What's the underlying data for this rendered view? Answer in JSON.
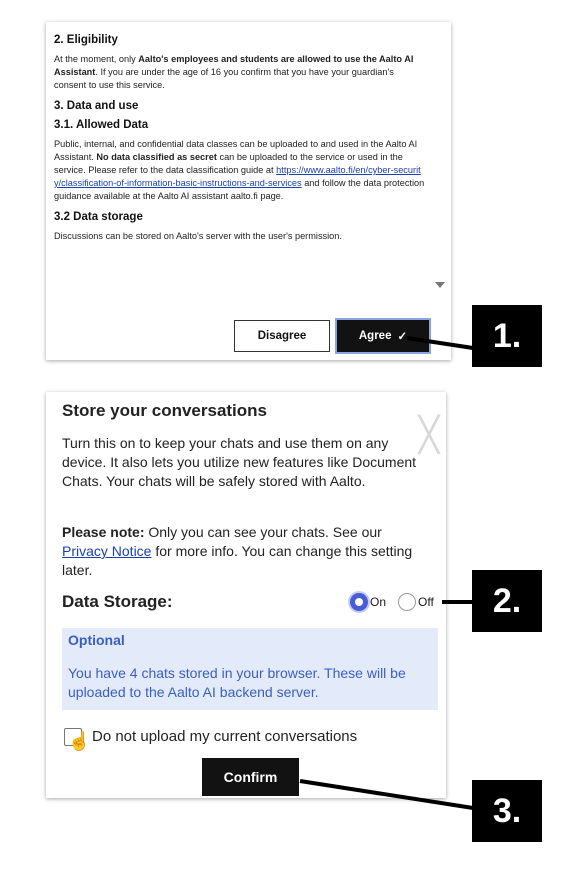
{
  "terms_dialog": {
    "eligibility_heading": "2. Eligibility",
    "eligibility_text_1": "At the moment, only ",
    "eligibility_bold": "Aalto's employees and students are allowed to use the Aalto AI Assistant",
    "eligibility_text_2": ". If you are under the age of 16 you confirm that you have your guardian's consent to use this service.",
    "data_use_heading": "3. Data and use",
    "allowed_heading": "3.1. Allowed Data",
    "allowed_text_1": "Public, internal, and confidential data classes can be uploaded to and used in the Aalto AI Assistant. ",
    "allowed_bold": "No data classified as secret",
    "allowed_text_2": " can be uploaded to the service or used in the service. Please refer to the data classification guide at ",
    "allowed_link": "https://www.aalto.fi/en/cyber-security/classification-of-information-basic-instructions-and-services",
    "allowed_text_3": " and follow the data protection guidance available at the Aalto AI assistant aalto.fi page.",
    "storage_heading": "3.2 Data storage",
    "storage_text": "Discussions can be stored on Aalto's server with the user's permission.",
    "disagree_label": "Disagree",
    "agree_label": "Agree",
    "agree_icon": "✓"
  },
  "store_dialog": {
    "title": "Store your conversations",
    "close_icon": "╳",
    "description": "Turn this on to keep your chats and use them on any device. It also lets you utilize new features like Document Chats. Your chats will be safely stored with Aalto.",
    "note_bold": "Please note:",
    "note_text_1": " Only you can see your chats. See our ",
    "note_link": "Privacy Notice",
    "note_text_2": " for more info. You can change this setting later.",
    "storage_label": "Data Storage:",
    "radio_on_label": "On",
    "radio_off_label": "Off",
    "selected": "On",
    "optional_title": "Optional",
    "optional_text": "You have 4 chats stored in your browser. These will be uploaded to the Aalto AI backend server.",
    "checkbox_label": "Do not upload my current conversations",
    "checkbox_checked": false,
    "confirm_label": "Confirm"
  },
  "callouts": {
    "one": "1.",
    "two": "2.",
    "three": "3."
  },
  "colors": {
    "accent": "#4a5cd6",
    "optional_bg": "#e3ebfb",
    "optional_text": "#3a5ec2",
    "button_dark": "#121212"
  }
}
